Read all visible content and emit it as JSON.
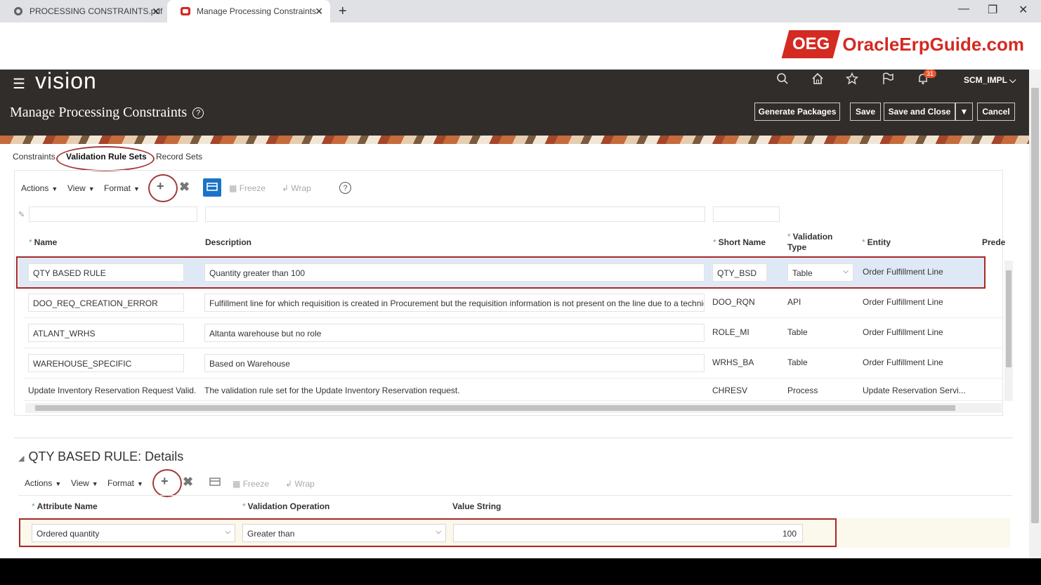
{
  "browser": {
    "tabs": [
      {
        "label": "PROCESSING CONSTRAINTS.pdf"
      },
      {
        "label": "Manage Processing Constraints -"
      }
    ]
  },
  "logo": {
    "badge": "OEG",
    "brand": "OracleErpGuide.com"
  },
  "header": {
    "app_name": "vision",
    "notification_count": "31",
    "user": "SCM_IMPL",
    "page_title": "Manage Processing Constraints",
    "buttons": {
      "generate": "Generate Packages",
      "save": "Save",
      "save_close": "Save and Close",
      "cancel": "Cancel"
    }
  },
  "subtabs": [
    "Constraints",
    "Validation Rule Sets",
    "Record Sets"
  ],
  "toolbar": {
    "actions": "Actions",
    "view": "View",
    "format": "Format",
    "freeze": "Freeze",
    "wrap": "Wrap"
  },
  "table": {
    "columns": {
      "name": "Name",
      "description": "Description",
      "short_name": "Short Name",
      "validation_type_1": "Validation",
      "validation_type_2": "Type",
      "entity": "Entity",
      "predecessor": "Prede"
    },
    "rows": [
      {
        "name": "QTY BASED RULE",
        "description": "Quantity greater than 100",
        "short_name": "QTY_BSD",
        "type": "Table",
        "entity": "Order Fulfillment Line"
      },
      {
        "name": "DOO_REQ_CREATION_ERROR",
        "description": "Fulfillment line for which requisition is created in Procurement but the requisition information is not present on the line due to a technical f",
        "short_name": "DOO_RQN",
        "type": "API",
        "entity": "Order Fulfillment Line"
      },
      {
        "name": "ATLANT_WRHS",
        "description": "Altanta warehouse but no role",
        "short_name": "ROLE_MI",
        "type": "Table",
        "entity": "Order Fulfillment Line"
      },
      {
        "name": "WAREHOUSE_SPECIFIC",
        "description": "Based on Warehouse",
        "short_name": "WRHS_BA",
        "type": "Table",
        "entity": "Order Fulfillment Line"
      },
      {
        "name": "Update Inventory Reservation Request Valid...",
        "description": "The validation rule set for the Update Inventory Reservation request.",
        "short_name": "CHRESV",
        "type": "Process",
        "entity": "Update Reservation Servi..."
      }
    ]
  },
  "details": {
    "title": "QTY BASED RULE: Details",
    "columns": {
      "attribute": "Attribute Name",
      "operation": "Validation Operation",
      "value": "Value String"
    },
    "row": {
      "attribute": "Ordered quantity",
      "operation": "Greater than",
      "value": "100"
    }
  },
  "colors": {
    "header_bg": "#312d2a",
    "selected_row": "#dfe9f6",
    "annotation_red": "#a82828",
    "brand_red": "#d32a22"
  }
}
